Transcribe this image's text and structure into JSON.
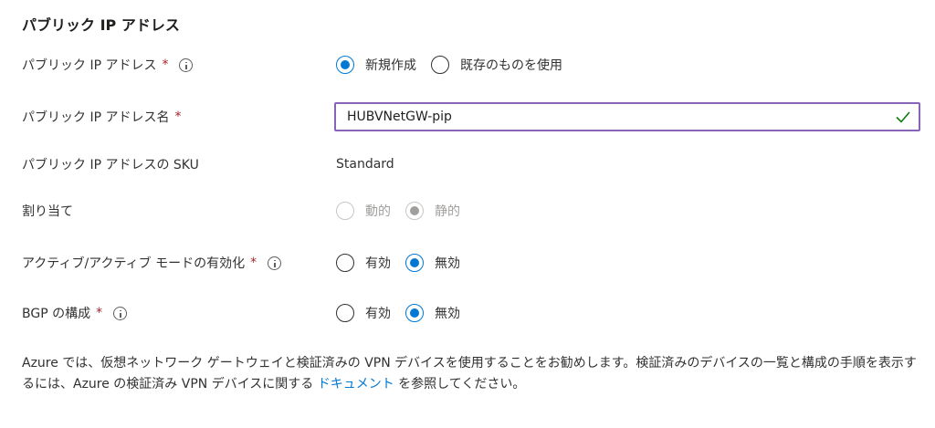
{
  "section": {
    "title": "パブリック IP アドレス"
  },
  "public_ip": {
    "label": "パブリック IP アドレス",
    "required": "*",
    "options": [
      {
        "label": "新規作成",
        "checked": true
      },
      {
        "label": "既存のものを使用",
        "checked": false
      }
    ]
  },
  "public_ip_name": {
    "label": "パブリック IP アドレス名",
    "required": "*",
    "value": "HUBVNetGW-pip"
  },
  "public_ip_sku": {
    "label": "パブリック IP アドレスの SKU",
    "value": "Standard"
  },
  "assignment": {
    "label": "割り当て",
    "options": [
      {
        "label": "動的",
        "checked": false,
        "disabled": true
      },
      {
        "label": "静的",
        "checked": true,
        "disabled": true
      }
    ]
  },
  "active_active": {
    "label": "アクティブ/アクティブ モードの有効化",
    "required": "*",
    "options": [
      {
        "label": "有効",
        "checked": false
      },
      {
        "label": "無効",
        "checked": true
      }
    ]
  },
  "bgp": {
    "label": "BGP の構成",
    "required": "*",
    "options": [
      {
        "label": "有効",
        "checked": false
      },
      {
        "label": "無効",
        "checked": true
      }
    ]
  },
  "description": {
    "text_before": "Azure では、仮想ネットワーク ゲートウェイと検証済みの VPN デバイスを使用することをお勧めします。検証済みのデバイスの一覧と構成の手順を表示するには、Azure の検証済み VPN デバイスに関する ",
    "link": "ドキュメント",
    "text_after": " を参照してください。"
  },
  "colors": {
    "accent": "#0078d4",
    "required": "#a4262c",
    "input_border": "#8764b8",
    "valid_check": "#107c10"
  },
  "icons": {
    "info": "info-icon",
    "valid": "checkmark-icon"
  }
}
